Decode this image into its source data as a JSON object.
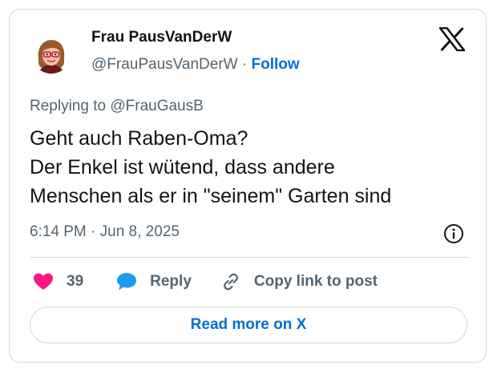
{
  "author": {
    "display_name": "Frau PausVanDerW",
    "handle": "@FrauPausVanDerW",
    "separator": "·",
    "follow_label": "Follow"
  },
  "reply": {
    "prefix": "Replying to",
    "mention": "@FrauGausB"
  },
  "tweet": {
    "lines": [
      "Geht auch Raben-Oma?",
      "Der Enkel ist wütend, dass andere",
      "Menschen als er in \"seinem\" Garten sind"
    ],
    "timestamp": "6:14 PM · Jun 8, 2025"
  },
  "actions": {
    "like_count": "39",
    "reply_label": "Reply",
    "copy_label": "Copy link to post"
  },
  "read_more_label": "Read more on X",
  "colors": {
    "accent": "#006fd6",
    "like": "#f91880",
    "reply_icon": "#1d9bf0",
    "muted": "#536471",
    "border": "#cfd9de"
  },
  "icons": [
    "x-logo-icon",
    "info-icon",
    "heart-icon",
    "reply-bubble-icon",
    "link-icon"
  ]
}
